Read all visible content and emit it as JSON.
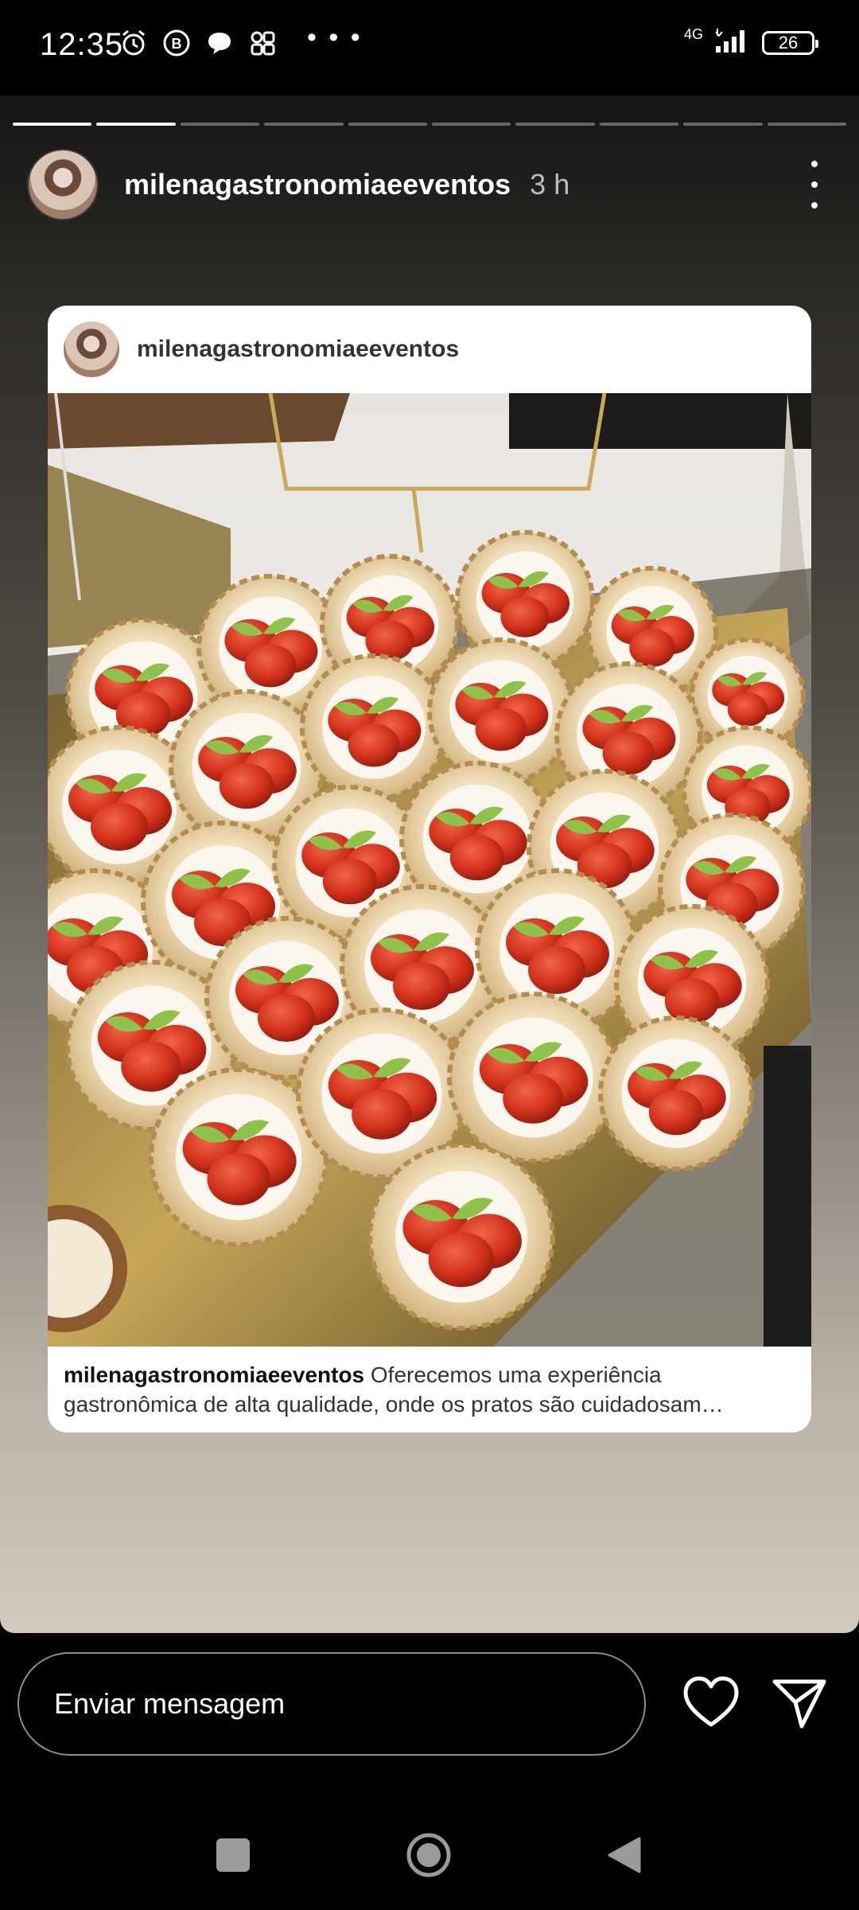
{
  "status_bar": {
    "time": "12:35",
    "left_icons": [
      "alarm-icon",
      "b-app-icon",
      "chat-bubble-icon",
      "app-grid-icon"
    ],
    "overflow": "• • •",
    "network": "4G",
    "battery": "26"
  },
  "story": {
    "segments_total": 10,
    "segments_viewed": 2,
    "username": "milenagastronomiaeeventos",
    "time_ago": "3 h",
    "post": {
      "username": "milenagastronomiaeeventos",
      "caption_user": "milenagastronomiaeeventos",
      "caption_text": "Oferecemos uma experiência gastronômica de alta qualidade, onde os pratos são cuidadosam…"
    }
  },
  "message_bar": {
    "placeholder": "Enviar mensagem"
  },
  "colors": {
    "background": "#000000",
    "card": "#ffffff",
    "tomato": "#d8391f"
  }
}
